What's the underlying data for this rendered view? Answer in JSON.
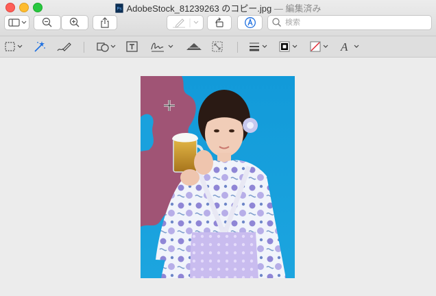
{
  "window": {
    "title": "AdobeStock_81239263 のコピー.jpg",
    "edited_suffix": "— 編集済み"
  },
  "toolbar": {
    "search_placeholder": "検索"
  },
  "colors": {
    "selection_fill": "#a05475",
    "photo_background": "#1ca1dd",
    "markup_bar": "#dedede",
    "window_bg": "#ececec"
  },
  "icons": [
    "sidebar-icon",
    "zoom-out-icon",
    "zoom-in-icon",
    "share-icon",
    "pen-icon",
    "rotate-icon",
    "markup-icon",
    "search-icon",
    "rect-selection-icon",
    "instant-alpha-icon",
    "sketch-icon",
    "shapes-icon",
    "text-icon",
    "sign-icon",
    "adjust-color-icon",
    "adjust-size-icon",
    "line-style-icon",
    "border-color-icon",
    "fill-color-icon",
    "text-style-icon",
    "crosshair-cursor-icon"
  ]
}
